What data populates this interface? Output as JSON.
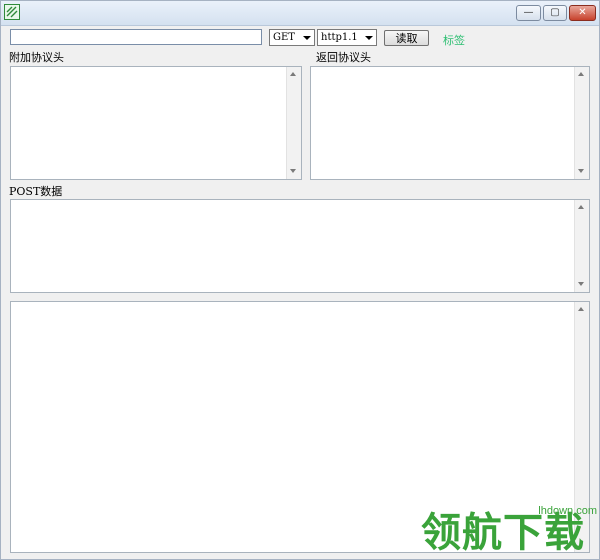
{
  "window": {
    "controls": {
      "minimize": "—",
      "restore": "▢",
      "close": "✕"
    }
  },
  "toolbar": {
    "url_value": "",
    "method_selected": "GET",
    "version_selected": "http1.1",
    "read_label": "读取",
    "tag_label": "标签"
  },
  "labels": {
    "request_headers": "附加协议头",
    "response_headers": "返回协议头",
    "post_data": "POST数据"
  },
  "watermark": {
    "site": "lhdown.com",
    "text": "领航下载"
  },
  "colors": {
    "accent_green": "#2fbf73",
    "watermark_green": "#3aa33a",
    "title_gradient_top": "#eaf1fa"
  }
}
